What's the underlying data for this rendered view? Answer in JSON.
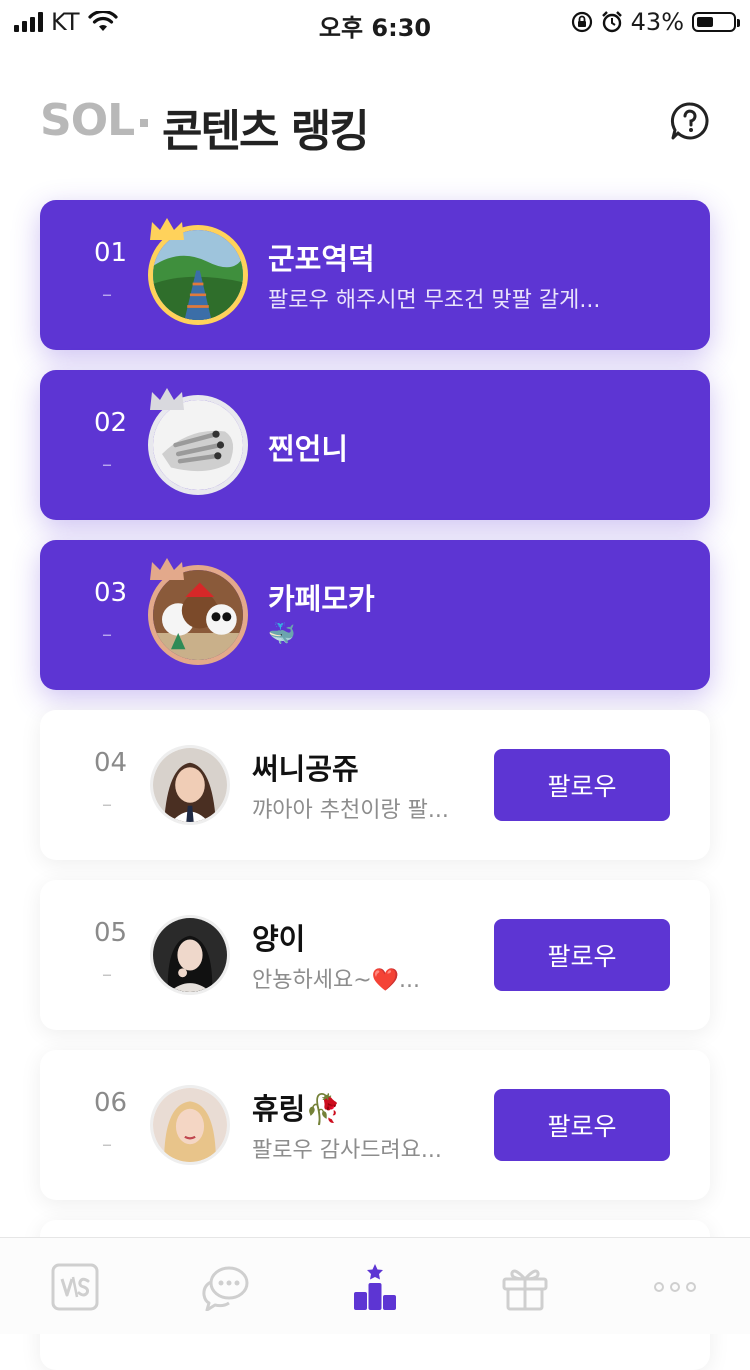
{
  "status_bar": {
    "carrier": "KT",
    "time": "오후 6:30",
    "battery_percent": "43%",
    "battery_level": 0.43
  },
  "header": {
    "brand": "SOL",
    "title": "콘텐츠 랭킹",
    "help_icon": "question-circle-icon"
  },
  "rankings": [
    {
      "rank": "01",
      "change": "–",
      "name": "군포역덕",
      "message": "팔로우 해주시면 무조건 맞팔 갈게...",
      "crown": "gold",
      "avatar": "bridge-forest-photo"
    },
    {
      "rank": "02",
      "change": "–",
      "name": "찐언니",
      "message": "",
      "crown": "silver",
      "avatar": "hand-photo"
    },
    {
      "rank": "03",
      "change": "–",
      "name": "카페모카",
      "message": "🐳",
      "crown": "bronze",
      "avatar": "three-bears-cartoon"
    },
    {
      "rank": "04",
      "change": "–",
      "name": "써니공쥬",
      "message": "꺄아아 추천이랑 팔...",
      "follow_label": "팔로우",
      "avatar": "girl-portrait"
    },
    {
      "rank": "05",
      "change": "–",
      "name": "양이",
      "message": "안뇽하세요~❤️...",
      "follow_label": "팔로우",
      "avatar": "woman-dark-portrait"
    },
    {
      "rank": "06",
      "change": "–",
      "name": "휴링🥀",
      "message": "팔로우 감사드려요...",
      "follow_label": "팔로우",
      "avatar": "blonde-portrait"
    }
  ],
  "colors": {
    "accent": "#5d35d3",
    "gold": "#ffd25b",
    "silver": "#d9d9de",
    "bronze": "#e3a98b",
    "nav_inactive": "#cfcfcf"
  },
  "bottom_nav": [
    {
      "icon": "vs-icon",
      "active": false
    },
    {
      "icon": "chat-bubbles-icon",
      "active": false
    },
    {
      "icon": "ranking-podium-icon",
      "active": true
    },
    {
      "icon": "gift-icon",
      "active": false
    },
    {
      "icon": "more-dots-icon",
      "active": false
    }
  ]
}
